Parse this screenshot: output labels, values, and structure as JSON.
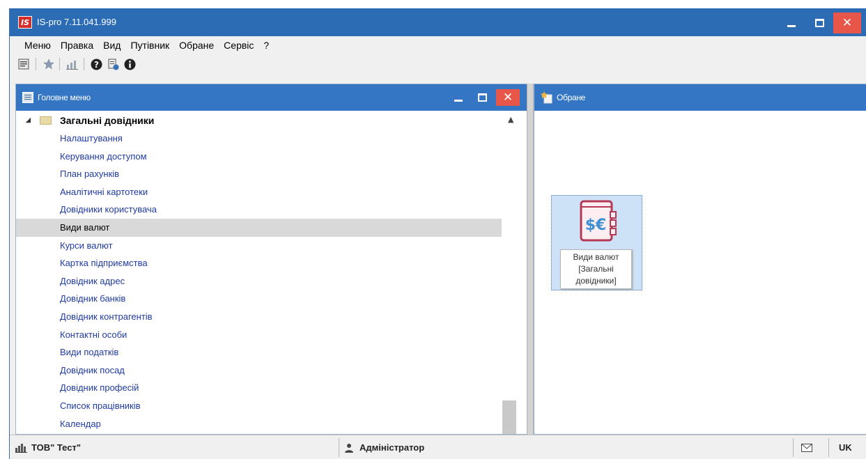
{
  "window": {
    "app_logo": "IS",
    "title": "IS-pro 7.11.041.999",
    "controls": [
      "minimize",
      "maximize",
      "close"
    ]
  },
  "menu": [
    "Меню",
    "Правка",
    "Вид",
    "Путівник",
    "Обране",
    "Сервіс",
    "?"
  ],
  "toolbar": {
    "icons": [
      "window-list-icon",
      "star-icon",
      "chart-icon",
      "help-icon",
      "document-help-icon",
      "info-icon"
    ]
  },
  "main_menu_panel": {
    "title": "Головне меню",
    "tree": {
      "root": "Загальні довідники",
      "items": [
        "Налаштування",
        "Керування доступом",
        "План рахунків",
        "Аналітичні картотеки",
        "Довідники користувача",
        "Види валют",
        "Курси валют",
        "Картка підприємства",
        "Довідник адрес",
        "Довідник банків",
        "Довідник контрагентів",
        "Контактні особи",
        "Види податків",
        "Довідник посад",
        "Довідник професій",
        "Список працівників",
        "Календар"
      ],
      "selected": "Види валют"
    }
  },
  "favorites_panel": {
    "title": "Обране",
    "tile": {
      "icon_text": "$€",
      "label_line1": "Види валют",
      "label_line2": "[Загальні",
      "label_line3": "довідники]"
    }
  },
  "status_bar": {
    "organization": "ТОВ\" Тест\"",
    "user": "Адміністратор",
    "language": "UK"
  },
  "colors": {
    "titlebar": "#2b6cb5",
    "panel_header": "#3576c4",
    "close_button": "#e8564a",
    "link_text": "#1f3aa3",
    "selection": "#d9d9d9",
    "tile_icon": "#b73a55"
  }
}
